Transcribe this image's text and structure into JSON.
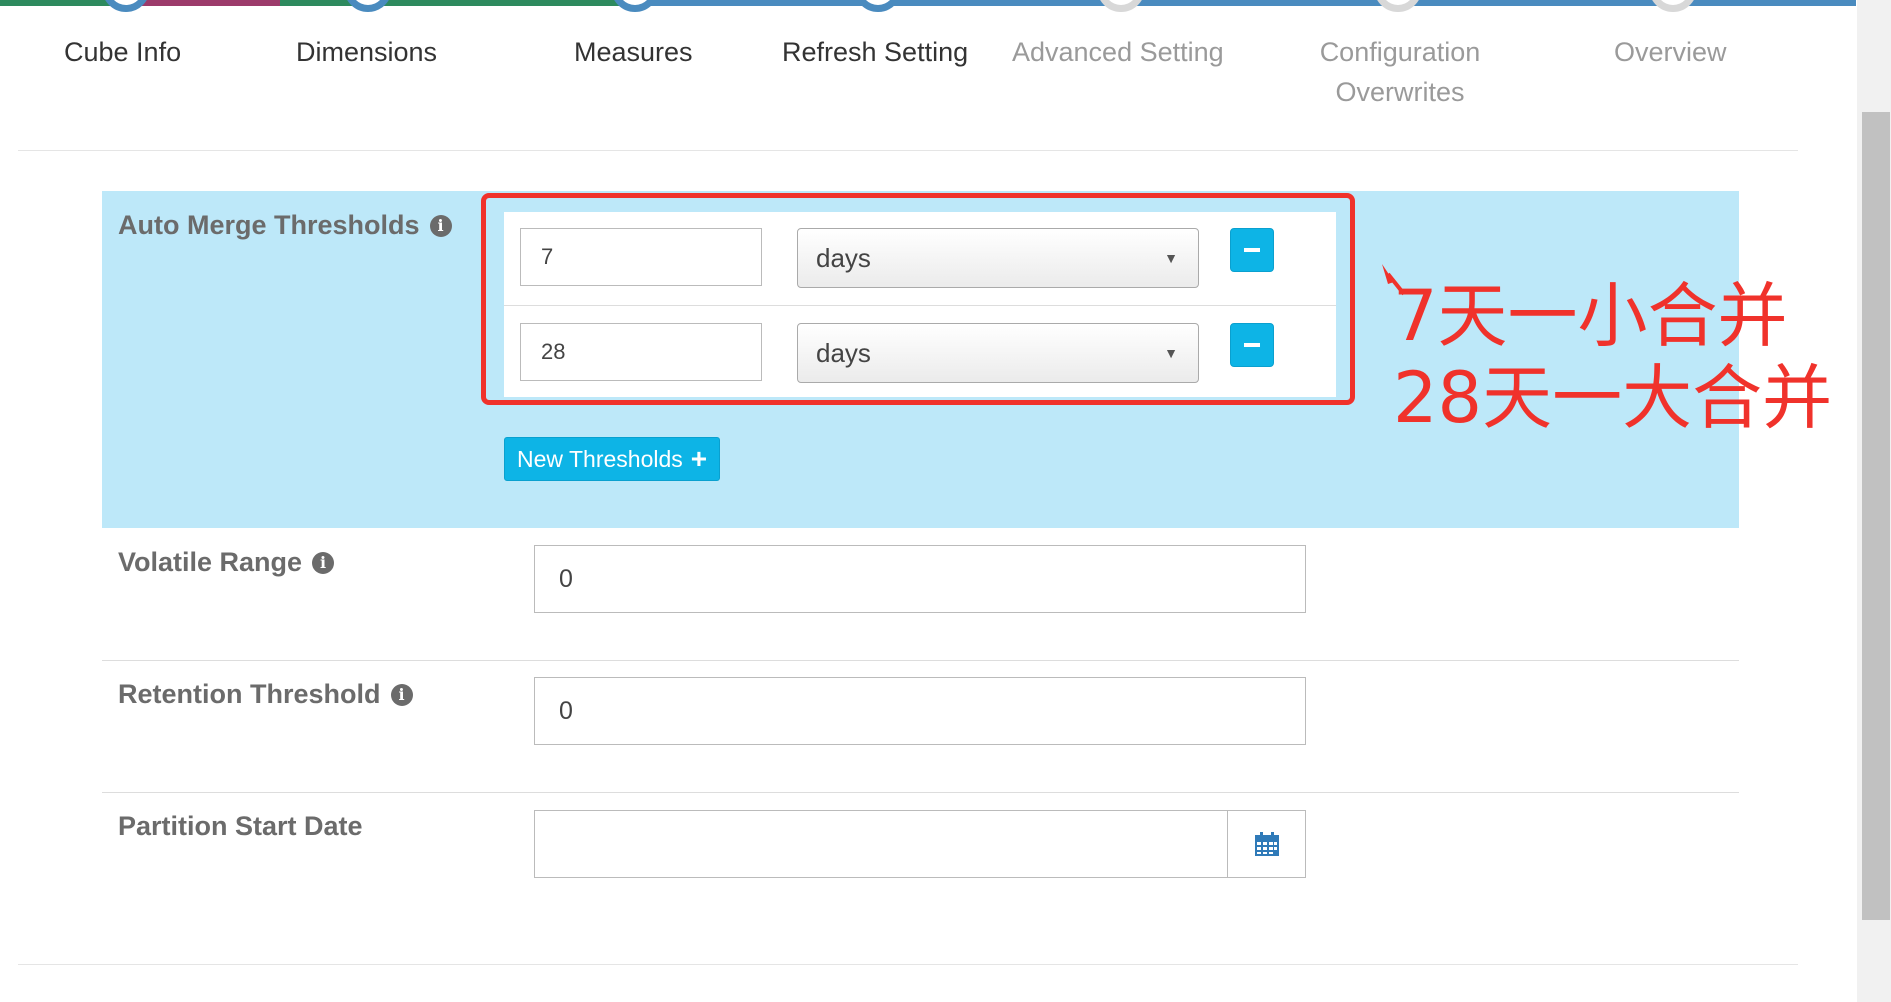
{
  "wizard": {
    "steps": [
      {
        "label": "Cube Info",
        "state": "done"
      },
      {
        "label": "Dimensions",
        "state": "done"
      },
      {
        "label": "Measures",
        "state": "done"
      },
      {
        "label": "Refresh Setting",
        "state": "active"
      },
      {
        "label": "Advanced Setting",
        "state": "inactive"
      },
      {
        "label": "Configuration Overwrites",
        "state": "inactive"
      },
      {
        "label": "Overview",
        "state": "inactive"
      }
    ],
    "active_color": "#4a8bbf",
    "inactive_color": "#d8d8d8"
  },
  "refresh": {
    "auto_merge": {
      "label": "Auto Merge Thresholds",
      "rows": [
        {
          "value": "7",
          "unit": "days"
        },
        {
          "value": "28",
          "unit": "days"
        }
      ],
      "new_button_label": "New Thresholds"
    },
    "volatile_range": {
      "label": "Volatile Range",
      "value": "0"
    },
    "retention_threshold": {
      "label": "Retention Threshold",
      "value": "0"
    },
    "partition_start_date": {
      "label": "Partition Start Date",
      "value": ""
    }
  },
  "annotation": {
    "line1": "7天一小合并",
    "line2": "28天一大合并",
    "color": "#f0322b"
  },
  "colors": {
    "panel_bg": "#bde8f9",
    "button": "#0db4e6"
  },
  "icons": [
    "info-icon",
    "minus-icon",
    "plus-icon",
    "calendar-icon",
    "dropdown-arrow-icon"
  ]
}
